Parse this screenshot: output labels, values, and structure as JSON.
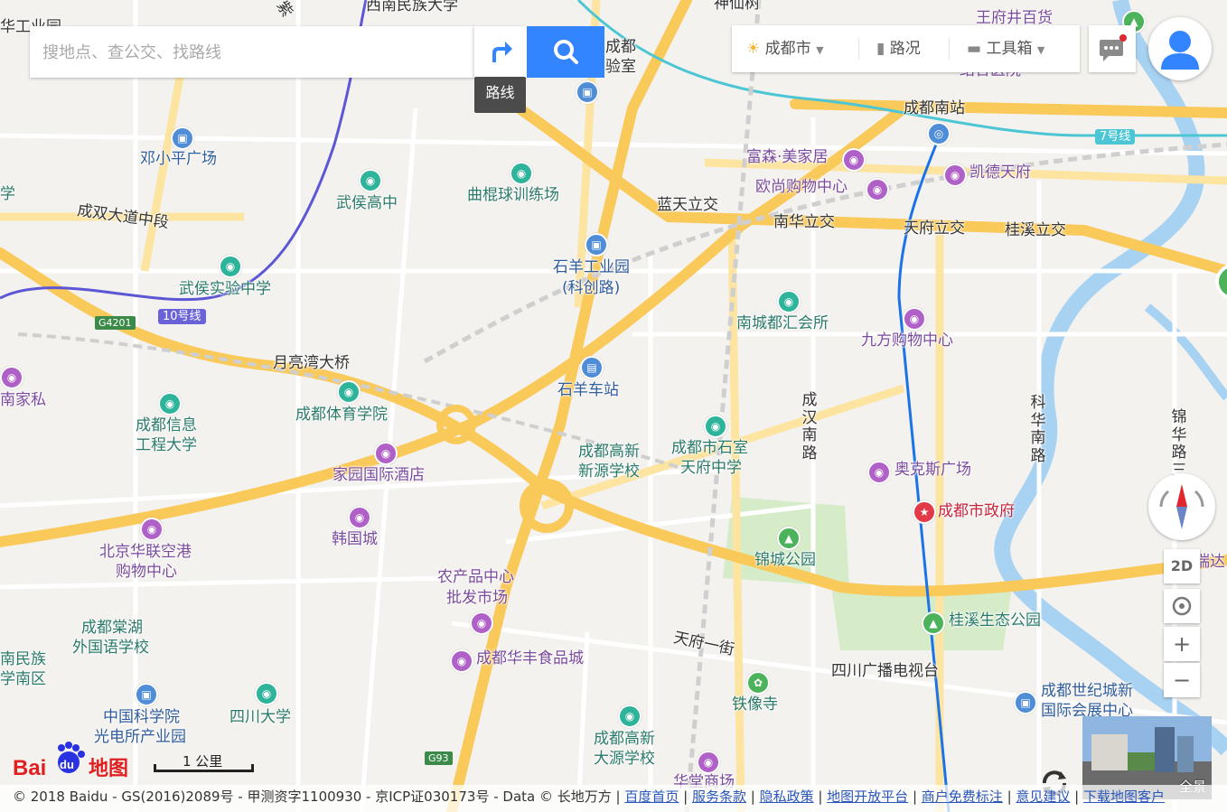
{
  "search": {
    "placeholder": "搜地点、查公交、找路线",
    "route_tooltip": "路线"
  },
  "toolbar": {
    "city": "成都市",
    "traffic": "路况",
    "toolbox": "工具箱"
  },
  "controls": {
    "mode_2d": "2D",
    "zoom_in": "+",
    "zoom_out": "−",
    "panorama_label": "全景"
  },
  "scale": {
    "label": "1 公里"
  },
  "footer": {
    "copyright": "© 2018 Baidu - GS(2016)2089号 - 甲测资字1100930 - 京ICP证030173号 - Data © 长地万方 |",
    "links": [
      "百度首页",
      "服务条款",
      "隐私政策",
      "地图开放平台",
      "商户免费标注",
      "意见建议",
      "下载地图客户"
    ]
  },
  "logo": {
    "text": "Bai du地图"
  },
  "labels": {
    "l1": "西南民族大学",
    "l2": "王府井百货",
    "l3": "成都",
    "l4": "验室",
    "l5": "结合医院",
    "l6": "成都南站",
    "l7": "邓小平广场",
    "l8": "富森·美家居",
    "l9": "凯德天府",
    "l10": "欧尚购物中心",
    "l11": "武侯高中",
    "l12": "曲棍球训练场",
    "l13": "成双大道中段",
    "l14": "蓝天立交",
    "l15": "南华立交",
    "l16": "天府立交",
    "l17": "桂溪立交",
    "l18": "石羊工业园",
    "l19": "(科创路)",
    "l20": "武侯实验中学",
    "l21": "南城都汇会所",
    "l22": "九方购物中心",
    "l23": "月亮湾大桥",
    "l24": "石羊车站",
    "l25": "成都体育学院",
    "l26": "成都信息",
    "l27": "工程大学",
    "l28": "成都高新",
    "l29": "新源学校",
    "l30": "成都市石室",
    "l31": "天府中学",
    "l32": "成汉南路",
    "l33": "科华南路",
    "l34": "锦华路三",
    "l35": "家园国际酒店",
    "l36": "奥克斯广场",
    "l37": "成都市政府",
    "l38": "韩国城",
    "l39": "北京华联空港",
    "l40": "购物中心",
    "l41": "锦城公园",
    "l42": "农产品中心",
    "l43": "批发市场",
    "l44": "成都棠湖",
    "l45": "外国语学校",
    "l46": "桂溪生态公园",
    "l47": "天府一街",
    "l48": "成都华丰食品城",
    "l49": "四川广播电视台",
    "l50": "铁像寺",
    "l51": "成都世纪城新",
    "l52": "国际会展中心",
    "l53": "中国科学院",
    "l54": "光电所产业园",
    "l55": "四川大学",
    "l56": "成都高新",
    "l57": "大源学校",
    "l58": "南民族",
    "l59": "学南区",
    "l60": "南家私",
    "l61": "学",
    "l62": "华工业园",
    "l63": "瑞达",
    "l64": "华堂商场",
    "l65": "神仙树",
    "l66": "紫"
  },
  "badges": {
    "line7": "7号线",
    "line10": "10号线",
    "g4201": "G4201",
    "g93": "G93"
  },
  "colors": {
    "accent": "#3385ff",
    "road_major": "#f9c95a",
    "road_minor": "#fde7a8",
    "metro_blue": "#1a73e8",
    "metro_purple": "#5d57d6",
    "river": "#a3cef1",
    "park": "#cfe8c5"
  }
}
